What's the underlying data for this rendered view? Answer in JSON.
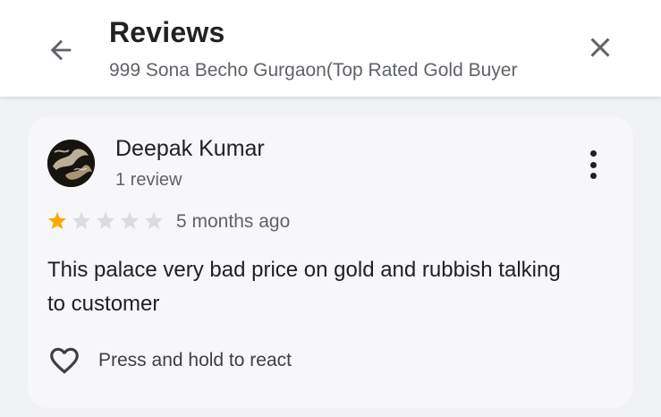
{
  "header": {
    "title": "Reviews",
    "subtitle": "999 Sona Becho Gurgaon(Top Rated Gold Buyer",
    "back_icon": "arrow-left-icon",
    "close_icon": "close-icon"
  },
  "review": {
    "author": "Deepak Kumar",
    "author_reviews": "1 review",
    "rating": 1,
    "max_rating": 5,
    "age": "5 months ago",
    "text": "This palace very bad price on gold and rubbish talking to customer",
    "react_label": "Press and hold to react",
    "react_icon": "heart-outline-icon",
    "more_icon": "more-vert-icon"
  },
  "colors": {
    "star_filled": "#f9ab00",
    "star_empty": "#dadce0",
    "card_bg": "#f7f7f9",
    "page_bg": "#f1f2f4"
  }
}
